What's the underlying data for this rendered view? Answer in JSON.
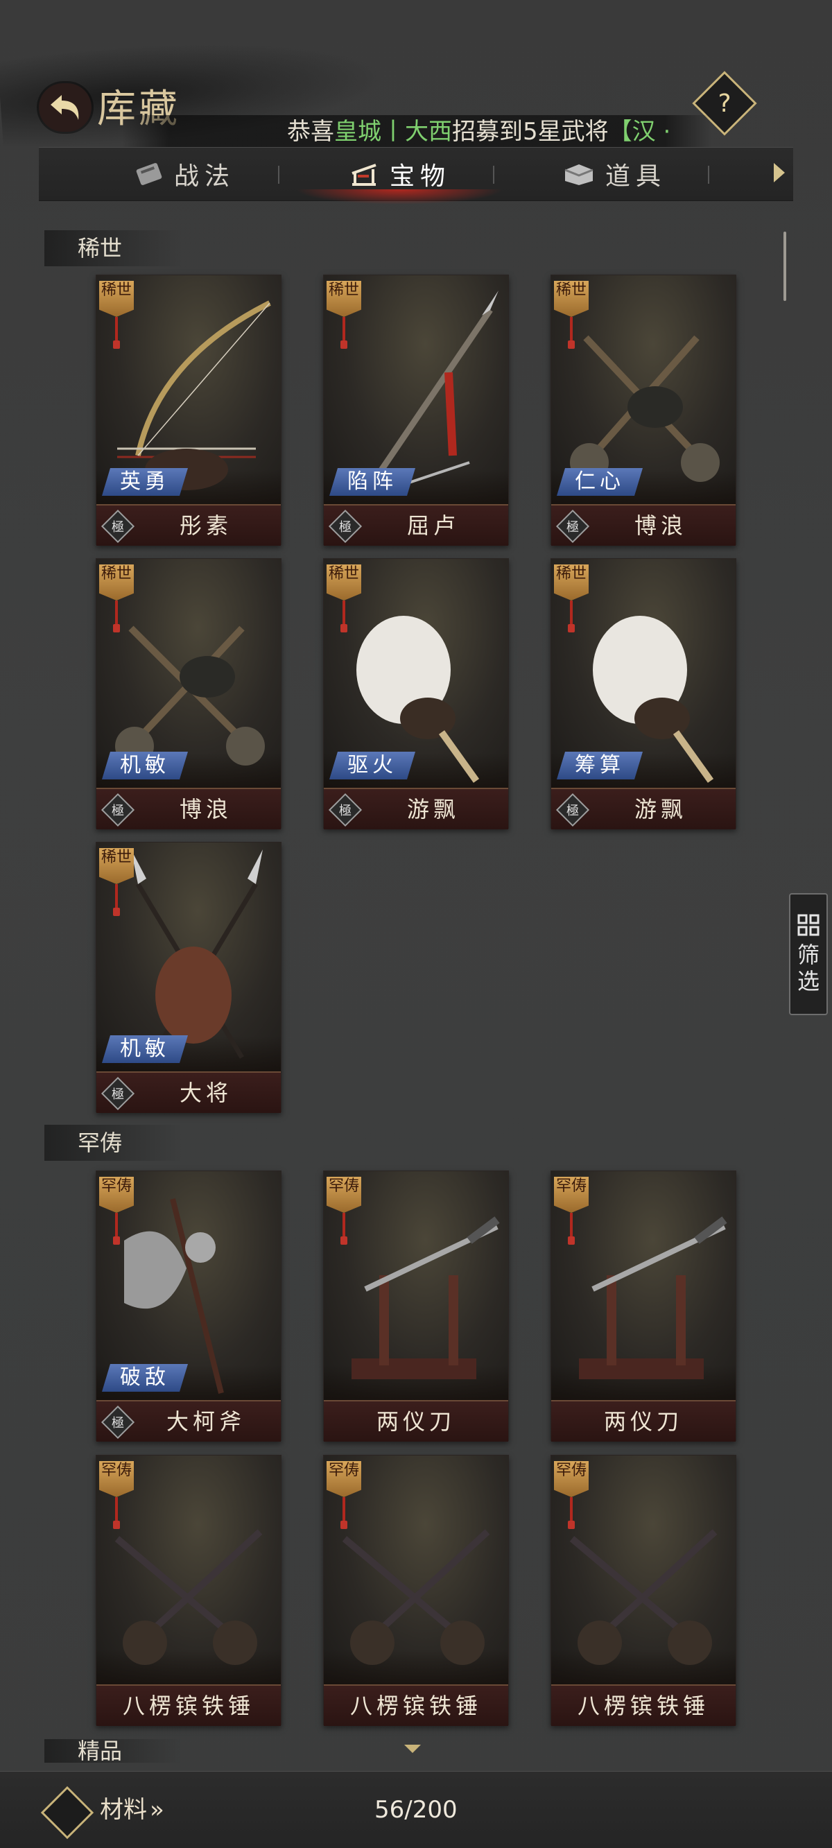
{
  "header": {
    "title": "库藏",
    "help_label": "?",
    "marquee": {
      "prefix": "恭喜",
      "city": "皇城",
      "separator": "丨",
      "player": "大西",
      "middle": "招募到5星武将",
      "bracket": "【",
      "general": "汉 ·"
    }
  },
  "tabs": [
    {
      "label": "战法",
      "icon": "scroll-icon"
    },
    {
      "label": "宝物",
      "icon": "weapon-rack-icon"
    },
    {
      "label": "道具",
      "icon": "chest-icon"
    }
  ],
  "sections": [
    {
      "title": "稀世"
    },
    {
      "title": "罕俦"
    },
    {
      "title": "精品"
    }
  ],
  "grade_label": "極",
  "rarity_labels": {
    "rare": "稀世",
    "uncommon": "罕俦"
  },
  "cards_rare": [
    {
      "tag": "英勇",
      "name": "彤素"
    },
    {
      "tag": "陷阵",
      "name": "屈卢"
    },
    {
      "tag": "仁心",
      "name": "博浪"
    },
    {
      "tag": "机敏",
      "name": "博浪"
    },
    {
      "tag": "驱火",
      "name": "游飘"
    },
    {
      "tag": "筹算",
      "name": "游飘"
    },
    {
      "tag": "机敏",
      "name": "大将"
    }
  ],
  "cards_uncommon": [
    {
      "tag": "破敌",
      "name": "大柯斧"
    },
    {
      "tag": "",
      "name": "两仪刀"
    },
    {
      "tag": "",
      "name": "两仪刀"
    },
    {
      "tag": "",
      "name": "八楞镔铁锤"
    },
    {
      "tag": "",
      "name": "八楞镔铁锤"
    },
    {
      "tag": "",
      "name": "八楞镔铁锤"
    }
  ],
  "filter": {
    "label_1": "筛",
    "label_2": "选"
  },
  "bottom": {
    "materials_label": "材料",
    "materials_arrow": "»",
    "capacity": "56/200"
  },
  "colors": {
    "accent_gold": "#c9b47a",
    "highlight_green": "#7fd06f",
    "tag_blue": "#3f5f9f"
  }
}
